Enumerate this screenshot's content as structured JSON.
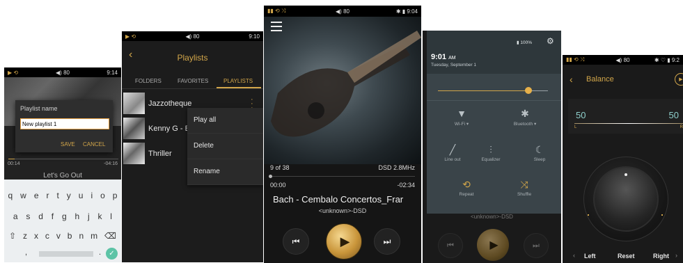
{
  "s1": {
    "status": {
      "vol": "◀) 80",
      "time": "9:14"
    },
    "dialog": {
      "title": "Playlist name",
      "value": "New playlist 1",
      "save": "SAVE",
      "cancel": "CANCEL"
    },
    "progress": {
      "elapsed": "00:14",
      "remaining": "-04:16",
      "fraction": 0.06
    },
    "song": "Let's Go Out",
    "keys_row1": [
      "q",
      "w",
      "e",
      "r",
      "t",
      "y",
      "u",
      "i",
      "o",
      "p"
    ],
    "keys_row2": [
      "a",
      "s",
      "d",
      "f",
      "g",
      "h",
      "j",
      "k",
      "l"
    ],
    "keys_row3": [
      "z",
      "x",
      "c",
      "v",
      "b",
      "n",
      "m"
    ]
  },
  "s2": {
    "status": {
      "vol": "◀) 80",
      "time": "9:10"
    },
    "title": "Playlists",
    "tabs": [
      "FOLDERS",
      "FAVORITES",
      "PLAYLISTS"
    ],
    "items": [
      "Jazzotheque",
      "Kenny G - E",
      "Thriller"
    ],
    "menu": [
      "Play all",
      "Delete",
      "Rename"
    ]
  },
  "s3": {
    "status": {
      "vol": "◀) 80",
      "time": "9:04"
    },
    "track_count": "9 of 38",
    "format": "DSD 2.8MHz",
    "elapsed": "00:00",
    "remaining": "-02:34",
    "title": "Bach - Cembalo Concertos_Frar",
    "artist": "<unknown>-DSD"
  },
  "s4": {
    "battery": "100%",
    "time": "9:01",
    "ampm": "AM",
    "date": "Tuesday, September 1",
    "brightness": 0.82,
    "tiles": [
      {
        "label": "Wi-Fi",
        "icon": "wifi-off-icon"
      },
      {
        "label": "Bluetooth",
        "icon": "bluetooth-icon"
      },
      {
        "label": "Line out",
        "icon": "line-out-icon"
      },
      {
        "label": "Equalizer",
        "icon": "equalizer-icon"
      },
      {
        "label": "Sleep",
        "icon": "sleep-icon"
      },
      {
        "label": "Repeat",
        "icon": "repeat-icon"
      },
      {
        "label": "Shuffle",
        "icon": "shuffle-icon"
      }
    ],
    "artist": "<unknown>-DSD"
  },
  "s5": {
    "status": {
      "vol": "◀) 80",
      "time": "9:2"
    },
    "title": "Balance",
    "left_value": "50",
    "right_value": "50",
    "left_tag": "L",
    "right_tag": "R",
    "buttons": {
      "left": "Left",
      "reset": "Reset",
      "right": "Right"
    }
  },
  "colors": {
    "gold": "#d2a64a",
    "accent": "#e6b04a",
    "panel": "#3a4449"
  }
}
